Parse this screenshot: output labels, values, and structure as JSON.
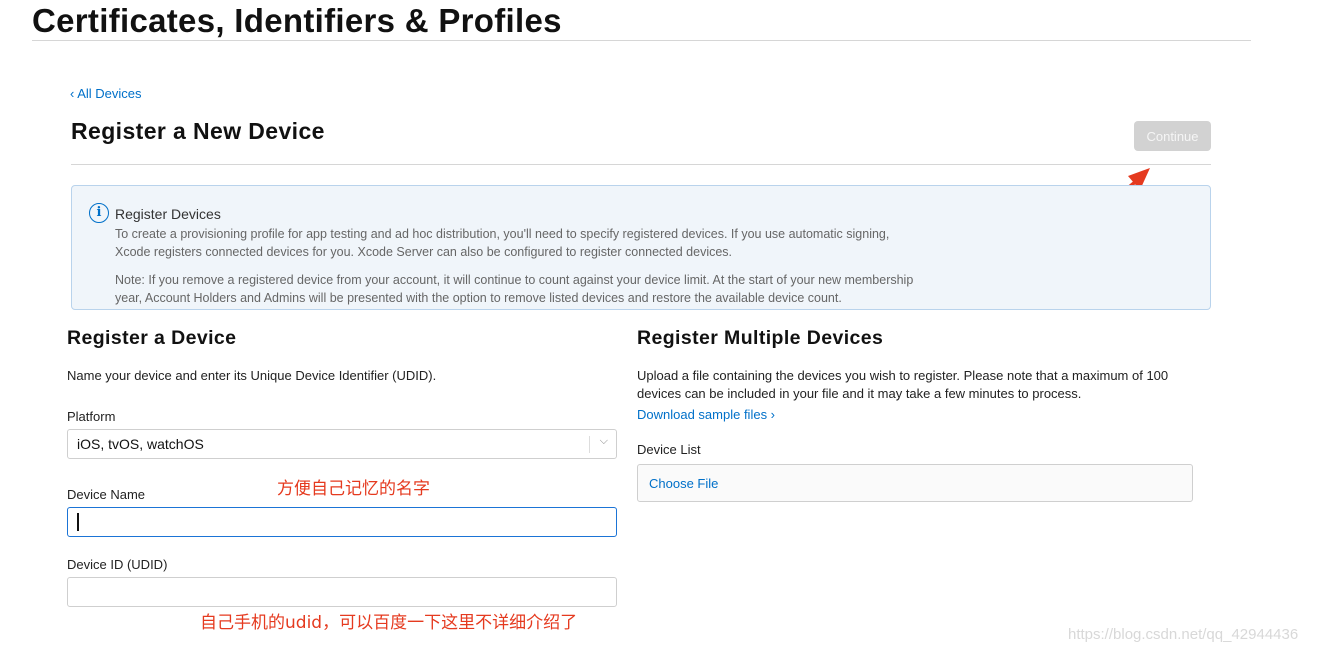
{
  "page": {
    "title": "Certificates, Identifiers & Profiles"
  },
  "nav": {
    "back_link": "‹ All Devices"
  },
  "header": {
    "title": "Register a New Device",
    "continue_label": "Continue"
  },
  "info": {
    "icon": "info-icon",
    "title": "Register Devices",
    "paragraph1": "To create a provisioning profile for app testing and ad hoc distribution, you'll need to specify registered devices. If you use automatic signing, Xcode registers connected devices for you. Xcode Server can also be configured to register connected devices.",
    "paragraph2": "Note: If you remove a registered device from your account, it will continue to count against your device limit. At the start of your new membership year, Account Holders and Admins will be presented with the option to remove listed devices and restore the available device count."
  },
  "single": {
    "title": "Register a Device",
    "description": "Name your device and enter its Unique Device Identifier (UDID).",
    "platform_label": "Platform",
    "platform_value": "iOS, tvOS, watchOS",
    "device_name_label": "Device Name",
    "device_id_label": "Device ID (UDID)"
  },
  "multiple": {
    "title": "Register Multiple Devices",
    "description": "Upload a file containing the devices you wish to register. Please note that a maximum of 100 devices can be included in your file and it may take a few minutes to process.",
    "download_link": "Download sample files ›",
    "device_list_label": "Device List",
    "choose_file_label": "Choose File"
  },
  "annotations": {
    "name_note": "方便自己记忆的名字",
    "udid_note": "自己手机的udid，可以百度一下这里不详细介绍了",
    "color": "#e53a1f"
  },
  "watermark": "https://blog.csdn.net/qq_42944436",
  "colors": {
    "link": "#0070c9",
    "info_bg": "#f0f5fa",
    "button_disabled": "#d2d2d2"
  }
}
